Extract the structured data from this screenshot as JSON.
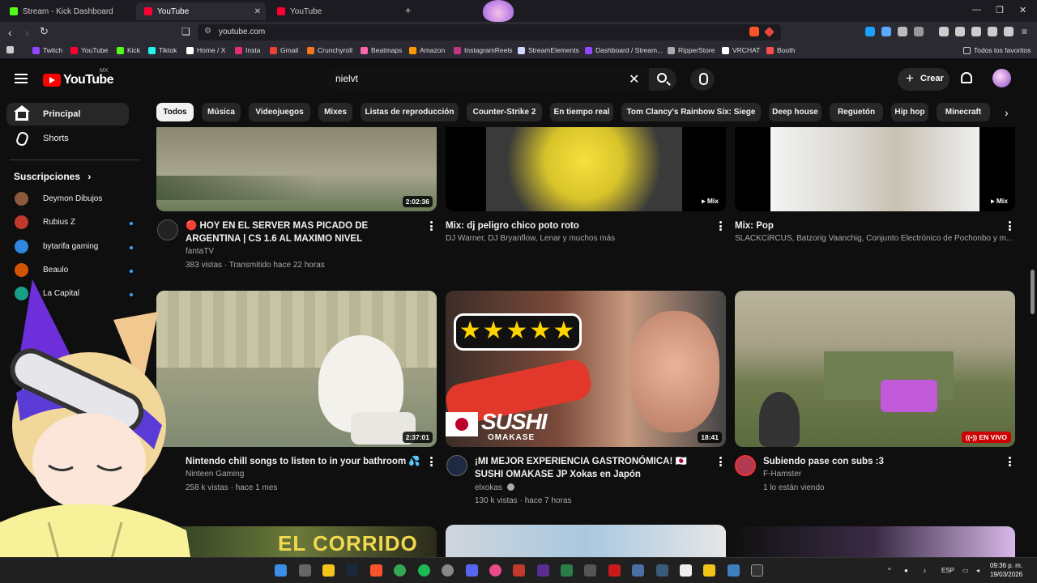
{
  "browser": {
    "tabs": [
      {
        "label": "Stream - Kick Dashboard",
        "fav_color": "#53fc18"
      },
      {
        "label": "YouTube",
        "fav_color": "#ff0033"
      },
      {
        "label": "YouTube",
        "fav_color": "#ff0033"
      }
    ],
    "new_tab": "+",
    "url": "youtube.com",
    "bookmarks": [
      {
        "label": "Twitch",
        "color": "#9146ff"
      },
      {
        "label": "YouTube",
        "color": "#ff0033"
      },
      {
        "label": "Kick",
        "color": "#53fc18"
      },
      {
        "label": "Tiktok",
        "color": "#25f4ee"
      },
      {
        "label": "Home / X",
        "color": "#ffffff"
      },
      {
        "label": "Insta",
        "color": "#e1306c"
      },
      {
        "label": "Gmail",
        "color": "#ea4335"
      },
      {
        "label": "Crunchyroll",
        "color": "#f47521"
      },
      {
        "label": "Beatmaps",
        "color": "#ff66aa"
      },
      {
        "label": "Amazon",
        "color": "#ff9900"
      },
      {
        "label": "InstagramReels",
        "color": "#c13584"
      },
      {
        "label": "StreamElements",
        "color": "#cfd8ff"
      },
      {
        "label": "Dashboard / Stream...",
        "color": "#9146ff"
      },
      {
        "label": "RipperStore",
        "color": "#aaaaaa"
      },
      {
        "label": "VRCHAT",
        "color": "#ffffff"
      },
      {
        "label": "Booth",
        "color": "#fc4d50"
      }
    ],
    "favorites_label": "Todos los favoritos"
  },
  "header": {
    "logo_text": "YouTube",
    "country": "MX",
    "search_value": "nielvt",
    "create_label": "Crear"
  },
  "chips": [
    "Todos",
    "Música",
    "Videojuegos",
    "Mixes",
    "Listas de reproducción",
    "Counter-Strike 2",
    "En tiempo real",
    "Tom Clancy's Rainbow Six: Siege",
    "Deep house",
    "Reguetón",
    "Hip hop",
    "Minecraft"
  ],
  "sidebar": {
    "items": [
      {
        "label": "Principal"
      },
      {
        "label": "Shorts"
      }
    ],
    "subs_title": "Suscripciones",
    "subs": [
      {
        "label": "Deymon Dibujos",
        "color": "#8b5a3c",
        "new": false
      },
      {
        "label": "Rubius Z",
        "color": "#c0392b",
        "new": true
      },
      {
        "label": "bytarifa gaming",
        "color": "#2e86de",
        "new": true
      },
      {
        "label": "Beaulo",
        "color": "#d35400",
        "new": true
      },
      {
        "label": "La Capital",
        "color": "#16a085",
        "new": true
      }
    ]
  },
  "videos": [
    {
      "title": "🔴 HOY EN EL SERVER MAS PICADO DE ARGENTINA | CS 1.6 AL MAXIMO NIVEL",
      "channel": "fantaTV",
      "meta": "383 vistas · Transmitido hace 22 horas",
      "badge": "2:02:36",
      "avatar": "#222222"
    },
    {
      "title": "Mix: dj peligro chico poto roto",
      "channel": "DJ Warner, DJ Bryanflow, Lenar y muchos más",
      "meta": "",
      "badge": "Mix",
      "avatar": ""
    },
    {
      "title": "Mix: Pop",
      "channel": "SLACKCiRCUS, Batzorig Vaanchig, Conjunto Electrónico de Pochonbo y m...",
      "meta": "",
      "badge": "Mix",
      "avatar": ""
    },
    {
      "title": "Nintendo chill songs to listen to in your bathroom 💦",
      "channel": "Ninteen Gaming",
      "meta": "258 k vistas · hace 1 mes",
      "badge": "2:37:01",
      "avatar": "#d9d9d9"
    },
    {
      "title": "¡MI MEJOR EXPERIENCIA GASTRONÓMICA! 🇯🇵 SUSHI OMAKASE JP Xokas en Japón",
      "channel": "elxokas",
      "meta": "130 k vistas · hace 7 horas",
      "badge": "18:41",
      "avatar": "#1e2a44"
    },
    {
      "title": "Subiendo pase con subs :3",
      "channel": "F-Hamster",
      "meta": "1 lo están viendo",
      "badge": "EN VIVO",
      "avatar": "#b33951"
    }
  ],
  "thumb_text": {
    "sushi": "SUSHI",
    "omakase": "OMAKASE",
    "corrido": "EL CORRIDO"
  },
  "taskbar": {
    "lang": "ESP",
    "time": "09:36 p. m.",
    "date": "19/03/2026"
  }
}
